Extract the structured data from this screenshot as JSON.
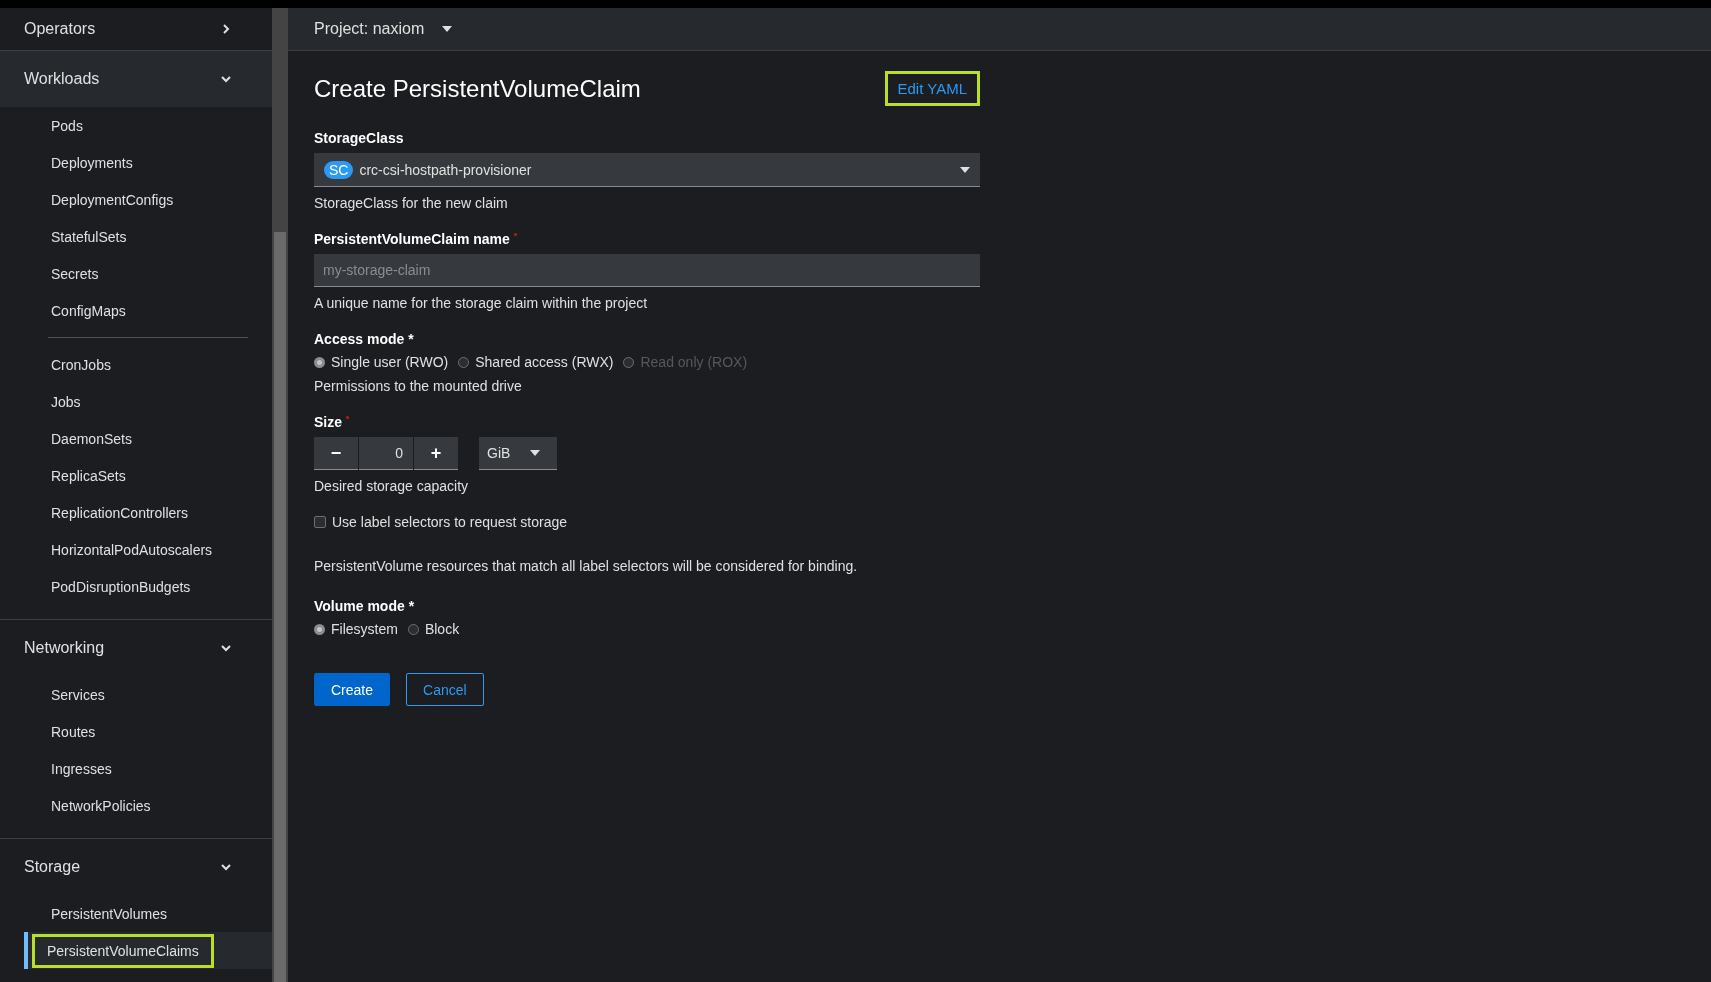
{
  "sidebar": {
    "sections": [
      {
        "title": "Operators",
        "expanded": false
      },
      {
        "title": "Workloads",
        "expanded": true,
        "groups": [
          [
            {
              "label": "Pods",
              "selected": false,
              "highlighted": false
            },
            {
              "label": "Deployments",
              "selected": false,
              "highlighted": false
            },
            {
              "label": "DeploymentConfigs",
              "selected": false,
              "highlighted": false
            },
            {
              "label": "StatefulSets",
              "selected": false,
              "highlighted": false
            },
            {
              "label": "Secrets",
              "selected": false,
              "highlighted": false
            },
            {
              "label": "ConfigMaps",
              "selected": false,
              "highlighted": false
            }
          ],
          [
            {
              "label": "CronJobs",
              "selected": false,
              "highlighted": false
            },
            {
              "label": "Jobs",
              "selected": false,
              "highlighted": false
            },
            {
              "label": "DaemonSets",
              "selected": false,
              "highlighted": false
            },
            {
              "label": "ReplicaSets",
              "selected": false,
              "highlighted": false
            },
            {
              "label": "ReplicationControllers",
              "selected": false,
              "highlighted": false
            },
            {
              "label": "HorizontalPodAutoscalers",
              "selected": false,
              "highlighted": false
            },
            {
              "label": "PodDisruptionBudgets",
              "selected": false,
              "highlighted": false
            }
          ]
        ]
      },
      {
        "title": "Networking",
        "expanded": true,
        "groups": [
          [
            {
              "label": "Services",
              "selected": false,
              "highlighted": false
            },
            {
              "label": "Routes",
              "selected": false,
              "highlighted": false
            },
            {
              "label": "Ingresses",
              "selected": false,
              "highlighted": false
            },
            {
              "label": "NetworkPolicies",
              "selected": false,
              "highlighted": false
            }
          ]
        ]
      },
      {
        "title": "Storage",
        "expanded": true,
        "groups": [
          [
            {
              "label": "PersistentVolumes",
              "selected": false,
              "highlighted": false
            },
            {
              "label": "PersistentVolumeClaims",
              "selected": true,
              "highlighted": true
            }
          ]
        ]
      }
    ]
  },
  "project": {
    "label": "Project: naxiom"
  },
  "page": {
    "title": "Create PersistentVolumeClaim",
    "edit_yaml": {
      "label": "Edit YAML",
      "highlighted": true
    }
  },
  "form": {
    "storage_class": {
      "label": "StorageClass",
      "badge": "SC",
      "value": "crc-csi-hostpath-provisioner",
      "help": "StorageClass for the new claim"
    },
    "claim_name": {
      "label": "PersistentVolumeClaim name",
      "required": true,
      "placeholder": "my-storage-claim",
      "help": "A unique name for the storage claim within the project"
    },
    "access_mode": {
      "label": "Access mode *",
      "options": [
        {
          "label": "Single user (RWO)",
          "selected": true,
          "disabled": false
        },
        {
          "label": "Shared access (RWX)",
          "selected": false,
          "disabled": false
        },
        {
          "label": "Read only (ROX)",
          "selected": false,
          "disabled": true
        }
      ],
      "help": "Permissions to the mounted drive"
    },
    "size": {
      "label": "Size",
      "required": true,
      "minus": "−",
      "value": "0",
      "plus": "+",
      "unit": "GiB",
      "help": "Desired storage capacity"
    },
    "label_selectors": {
      "label": "Use label selectors to request storage",
      "checked": false,
      "help": "PersistentVolume resources that match all label selectors will be considered for binding."
    },
    "volume_mode": {
      "label": "Volume mode *",
      "options": [
        {
          "label": "Filesystem",
          "selected": true,
          "disabled": false
        },
        {
          "label": "Block",
          "selected": false,
          "disabled": false
        }
      ]
    },
    "buttons": [
      {
        "label": "Create",
        "kind": "primary"
      },
      {
        "label": "Cancel",
        "kind": "secondary"
      }
    ]
  }
}
